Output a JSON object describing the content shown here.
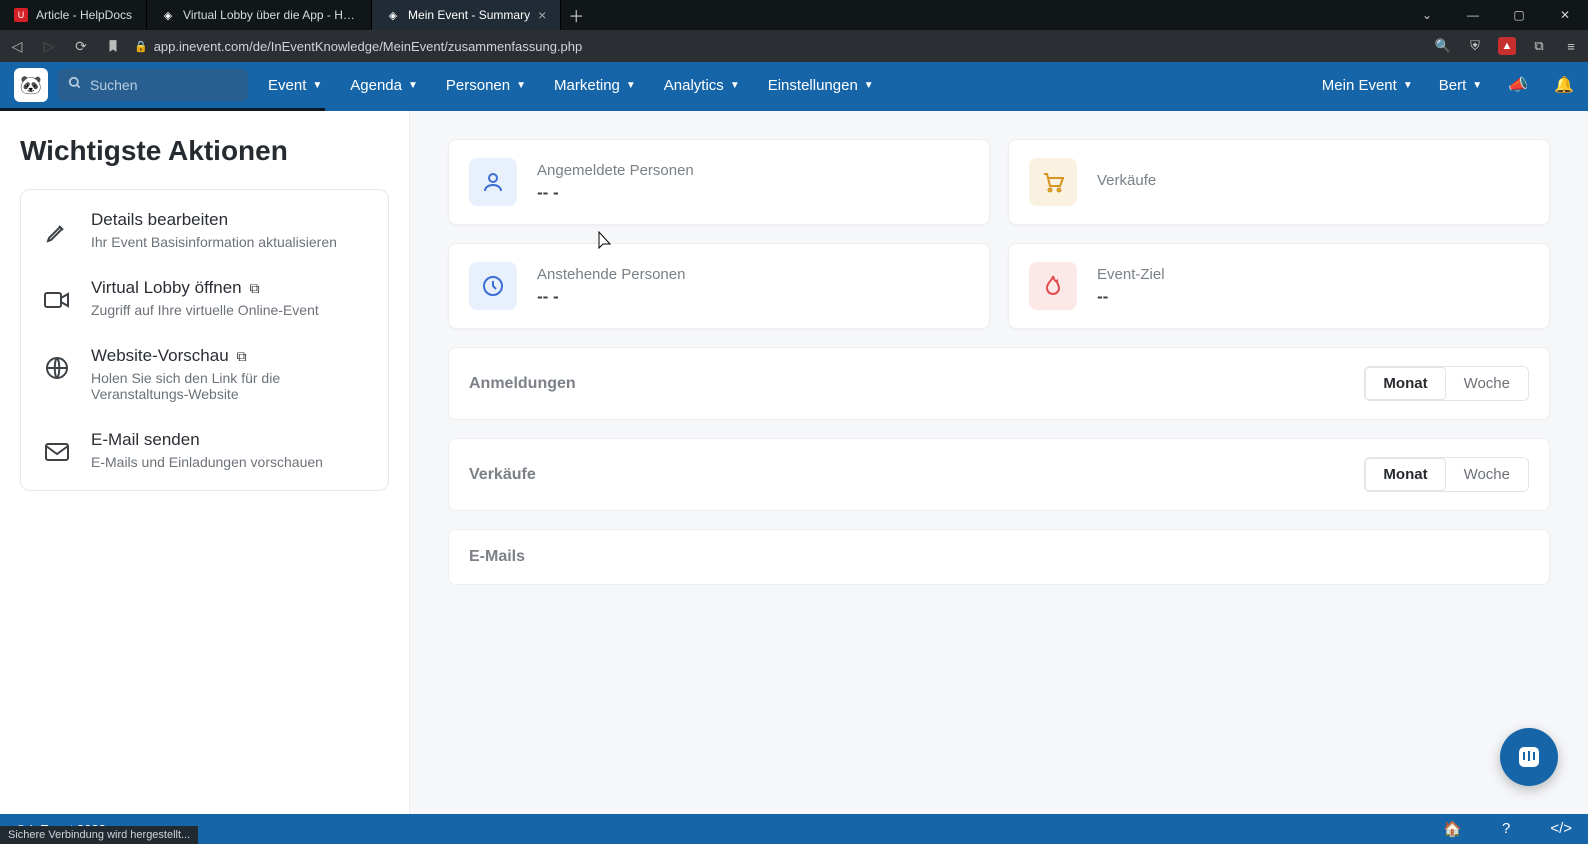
{
  "browser": {
    "tabs": [
      {
        "label": "Article - HelpDocs"
      },
      {
        "label": "Virtual Lobby über die App - HelpDocs"
      },
      {
        "label": "Mein Event - Summary"
      }
    ],
    "url": "app.inevent.com/de/InEventKnowledge/MeinEvent/zusammenfassung.php",
    "status_message": "Sichere Verbindung wird hergestellt..."
  },
  "nav": {
    "search_placeholder": "Suchen",
    "menus": [
      "Event",
      "Agenda",
      "Personen",
      "Marketing",
      "Analytics",
      "Einstellungen"
    ],
    "context_label": "Mein Event",
    "user_label": "Bert"
  },
  "sidebar": {
    "heading": "Wichtigste Aktionen",
    "actions": [
      {
        "title": "Details bearbeiten",
        "sub": "Ihr Event Basisinformation aktualisieren",
        "ext": false
      },
      {
        "title": "Virtual Lobby öffnen",
        "sub": "Zugriff auf Ihre virtuelle Online-Event",
        "ext": true
      },
      {
        "title": "Website-Vorschau",
        "sub": "Holen Sie sich den Link für die Veranstaltungs-Website",
        "ext": true
      },
      {
        "title": "E-Mail senden",
        "sub": "E-Mails und Einladungen vorschauen",
        "ext": false
      }
    ]
  },
  "stats": {
    "registered": {
      "label": "Angemeldete Personen",
      "value": "-- -"
    },
    "sales": {
      "label": "Verkäufe",
      "value": ""
    },
    "pending": {
      "label": "Anstehende Personen",
      "value": "-- -"
    },
    "goal": {
      "label": "Event-Ziel",
      "value": "--"
    }
  },
  "panels": {
    "registrations": {
      "title": "Anmeldungen",
      "seg_month": "Monat",
      "seg_week": "Woche"
    },
    "sales": {
      "title": "Verkäufe",
      "seg_month": "Monat",
      "seg_week": "Woche"
    },
    "emails": {
      "title": "E-Mails"
    }
  },
  "footer": {
    "copyright": "® InEvent 2022"
  }
}
